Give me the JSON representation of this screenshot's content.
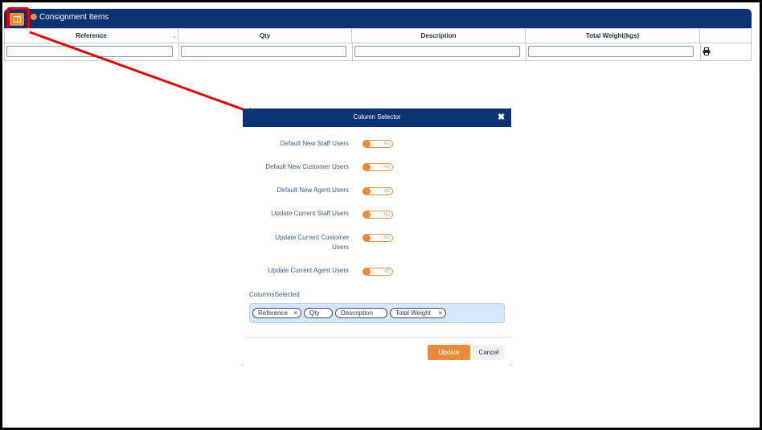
{
  "panel": {
    "title": "Consignment Items",
    "accent": "#e98a3e",
    "header_color": "#0b3272"
  },
  "table": {
    "columns": [
      "Reference",
      "Qty",
      "Description",
      "Total Weight(kgs)"
    ],
    "sort_icon": "chevron-down-icon",
    "print_icon": "printer-icon"
  },
  "modal": {
    "title": "Column Selector",
    "close_icon": "close-icon",
    "options": [
      {
        "label": "Default New Staff Users",
        "state": "NO"
      },
      {
        "label": "Default New Customer Users",
        "state": "NO"
      },
      {
        "label": "Default New Agent Users",
        "state": "NO"
      },
      {
        "label": "Update Current Staff Users",
        "state": "NO"
      },
      {
        "label": "Update Current Customer Users",
        "state": "NO"
      },
      {
        "label": "Update Current Agent Users",
        "state": "NO"
      }
    ],
    "columns_label": "ColumnsSelected",
    "chips": [
      {
        "label": "Reference",
        "removable": true
      },
      {
        "label": "Qty",
        "removable": false
      },
      {
        "label": "Description",
        "removable": false
      },
      {
        "label": "Total Weight",
        "removable": true
      }
    ],
    "chip_remove": "×",
    "update_label": "Update",
    "cancel_label": "Cancel"
  },
  "annotation": {
    "color": "#e00000"
  }
}
